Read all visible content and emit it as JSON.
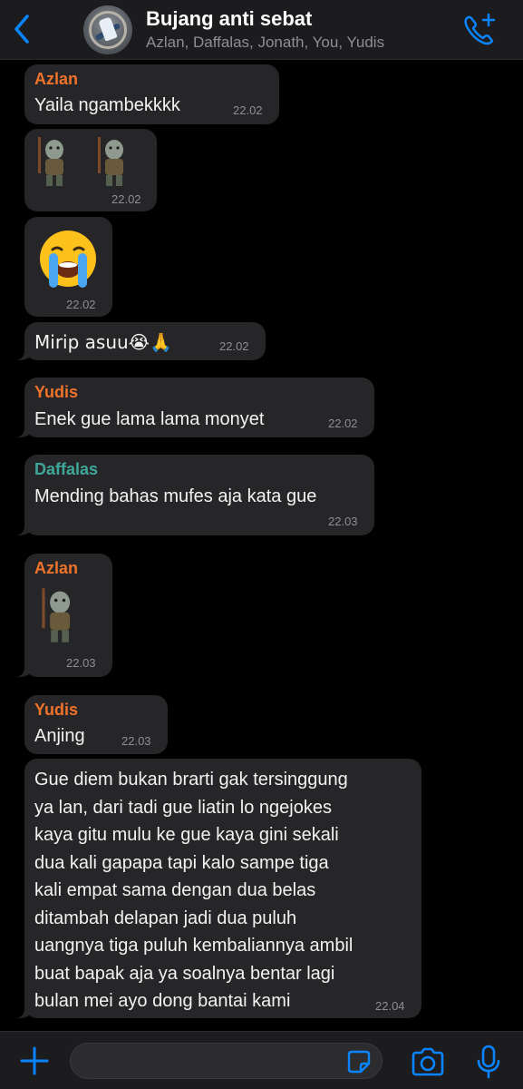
{
  "header": {
    "back_icon": "chevron-left-icon",
    "title": "Bujang anti sebat",
    "members": "Azlan, Daffalas, Jonath, You, Yudis",
    "call_icon": "phone-add-icon"
  },
  "colors": {
    "accent": "#0a84ff",
    "sender_orange": "#f0732b",
    "sender_teal": "#3fa79a",
    "bubble": "#262628",
    "background": "#000000"
  },
  "messages": [
    {
      "sender": "Azlan",
      "text": "Yaila ngambekkkk",
      "time": "22.02"
    },
    {
      "sticker": "troll-sticker",
      "count": 2,
      "time": "22.02"
    },
    {
      "emoji": "loudly-crying-face",
      "time": "22.02"
    },
    {
      "text": "Mirip asuu😭🙏",
      "time": "22.02"
    },
    {
      "sender": "Yudis",
      "text": "Enek gue lama lama monyet",
      "time": "22.02"
    },
    {
      "sender": "Daffalas",
      "text": "Mending bahas mufes aja kata gue",
      "time": "22.03"
    },
    {
      "sender": "Azlan",
      "sticker": "troll-sticker",
      "time": "22.03"
    },
    {
      "sender": "Yudis",
      "text": "Anjing",
      "time": "22.03"
    },
    {
      "lines": [
        "Gue diem bukan brarti gak tersinggung",
        "ya lan, dari tadi gue liatin lo ngejokes",
        "kaya gitu mulu ke gue kaya gini sekali",
        "dua kali gapapa tapi  kalo sampe tiga",
        "kali empat sama dengan dua belas",
        "ditambah delapan jadi dua puluh",
        "uangnya tiga puluh kembaliannya ambil",
        "buat bapak aja ya soalnya bentar lagi",
        "bulan mei ayo dong bantai kami"
      ],
      "time": "22.04"
    }
  ],
  "input": {
    "plus_icon": "plus-icon",
    "sticker_icon": "sticker-icon",
    "camera_icon": "camera-icon",
    "mic_icon": "microphone-icon"
  }
}
